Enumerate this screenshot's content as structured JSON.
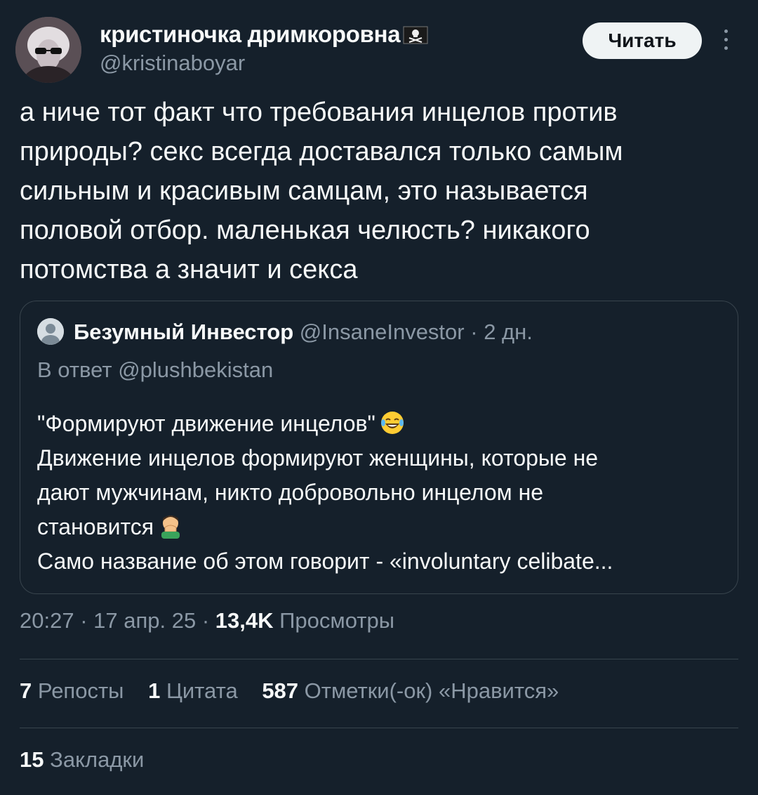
{
  "author": {
    "display_name": "кристиночка дримкоровна",
    "handle": "@kristinaboyar",
    "follow_label": "Читать"
  },
  "tweet": {
    "text": "а ниче тот факт что требования инцелов против\nприроды? секс всегда доставался только самым\nсильным и красивым самцам, это называется\nполовой отбор. маленькая челюсть? никакого\nпотомства а значит и секса"
  },
  "quote": {
    "name": "Безумный Инвестор",
    "handle": "@InsaneInvestor",
    "separator": " · ",
    "time": "2 дн.",
    "reply_to": "В ответ @plushbekistan",
    "lines": [
      "\"Формируют движение инцелов\"",
      "Движение инцелов формируют женщины, которые не",
      "дают мужчинам, никто добровольно инцелом не",
      "становится",
      "Само название об этом говорит -  «involuntary celibate..."
    ],
    "emoji_1": "face-with-tears-of-joy",
    "emoji_2": "man-facepalming"
  },
  "meta": {
    "time": "20:27",
    "date": "17 апр. 25",
    "sep": " · ",
    "views_count": "13,4K",
    "views_label": "Просмотры"
  },
  "stats": {
    "reposts_count": "7",
    "reposts_label": "Репосты",
    "quotes_count": "1",
    "quotes_label": "Цитата",
    "likes_count": "587",
    "likes_label": "Отметки(-ок) «Нравится»",
    "bookmarks_count": "15",
    "bookmarks_label": "Закладки"
  },
  "colors": {
    "background": "#15202b",
    "text_primary": "#f7f9f9",
    "text_secondary": "#8b98a5",
    "border": "#38444d",
    "follow_button_bg": "#eff3f4"
  }
}
